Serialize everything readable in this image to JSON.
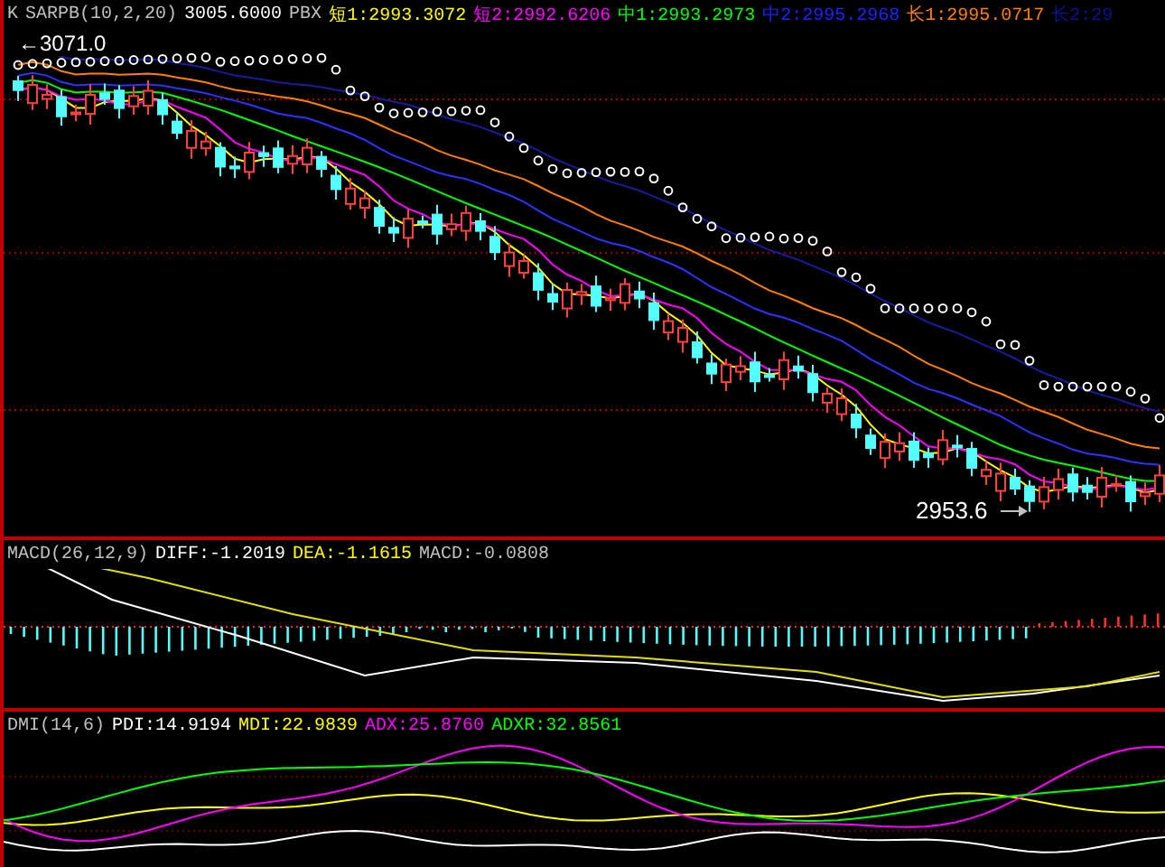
{
  "main": {
    "header": [
      {
        "text": "K",
        "color": "#c0c0c0"
      },
      {
        "text": "SARPB(10,2,20)",
        "color": "#c0c0c0"
      },
      {
        "text": "3005.6000",
        "color": "#ffffff"
      },
      {
        "text": "PBX",
        "color": "#c0c0c0"
      },
      {
        "text": "短1:2993.3072",
        "color": "#ffff00"
      },
      {
        "text": "短2:2992.6206",
        "color": "#ff00ff"
      },
      {
        "text": "中1:2993.2973",
        "color": "#00ff00"
      },
      {
        "text": "中2:2995.2968",
        "color": "#2020ff"
      },
      {
        "text": "长1:2995.0717",
        "color": "#ff8000"
      },
      {
        "text": "长2:29",
        "color": "#101090"
      }
    ],
    "high_label": "←3071.0",
    "low_label": "2953.6"
  },
  "macd": {
    "header": [
      {
        "text": "MACD(26,12,9)",
        "color": "#c0c0c0"
      },
      {
        "text": "DIFF:-1.2019",
        "color": "#ffffff"
      },
      {
        "text": "DEA:-1.1615",
        "color": "#ffff00"
      },
      {
        "text": "MACD:-0.0808",
        "color": "#c0c0c0"
      }
    ]
  },
  "dmi": {
    "header": [
      {
        "text": "DMI(14,6)",
        "color": "#c0c0c0"
      },
      {
        "text": "PDI:14.9194",
        "color": "#ffffff"
      },
      {
        "text": "MDI:22.9839",
        "color": "#ffff00"
      },
      {
        "text": "ADX:25.8760",
        "color": "#ff00ff"
      },
      {
        "text": "ADXR:32.8561",
        "color": "#00ff00"
      }
    ]
  }
}
